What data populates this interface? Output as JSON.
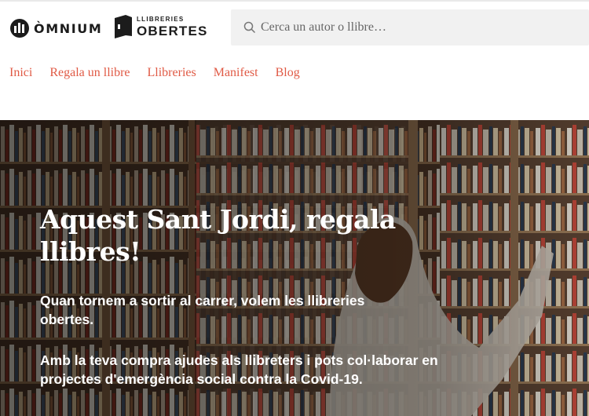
{
  "header": {
    "brand_omnium": "ÒMNIUM",
    "brand_llibreries_small": "LLIBRERIES",
    "brand_llibreries_big": "OBERTES",
    "search": {
      "placeholder": "Cerca un autor o llibre…",
      "icon": "search-icon"
    }
  },
  "nav": {
    "items": [
      {
        "label": "Inici"
      },
      {
        "label": "Regala un llibre"
      },
      {
        "label": "Llibreries"
      },
      {
        "label": "Manifest"
      },
      {
        "label": "Blog"
      }
    ]
  },
  "hero": {
    "title": "Aquest Sant Jordi, regala llibres!",
    "paragraph1": "Quan tornem a sortir al carrer, volem les llibreries obertes.",
    "paragraph2": "Amb la teva compra ajudes als llibreters i pots col·laborar en projectes d'emergència social contra la Covid-19."
  },
  "colors": {
    "accent": "#e05a45",
    "text_dark": "#1c1c1c",
    "search_bg": "#f1f1f1"
  }
}
